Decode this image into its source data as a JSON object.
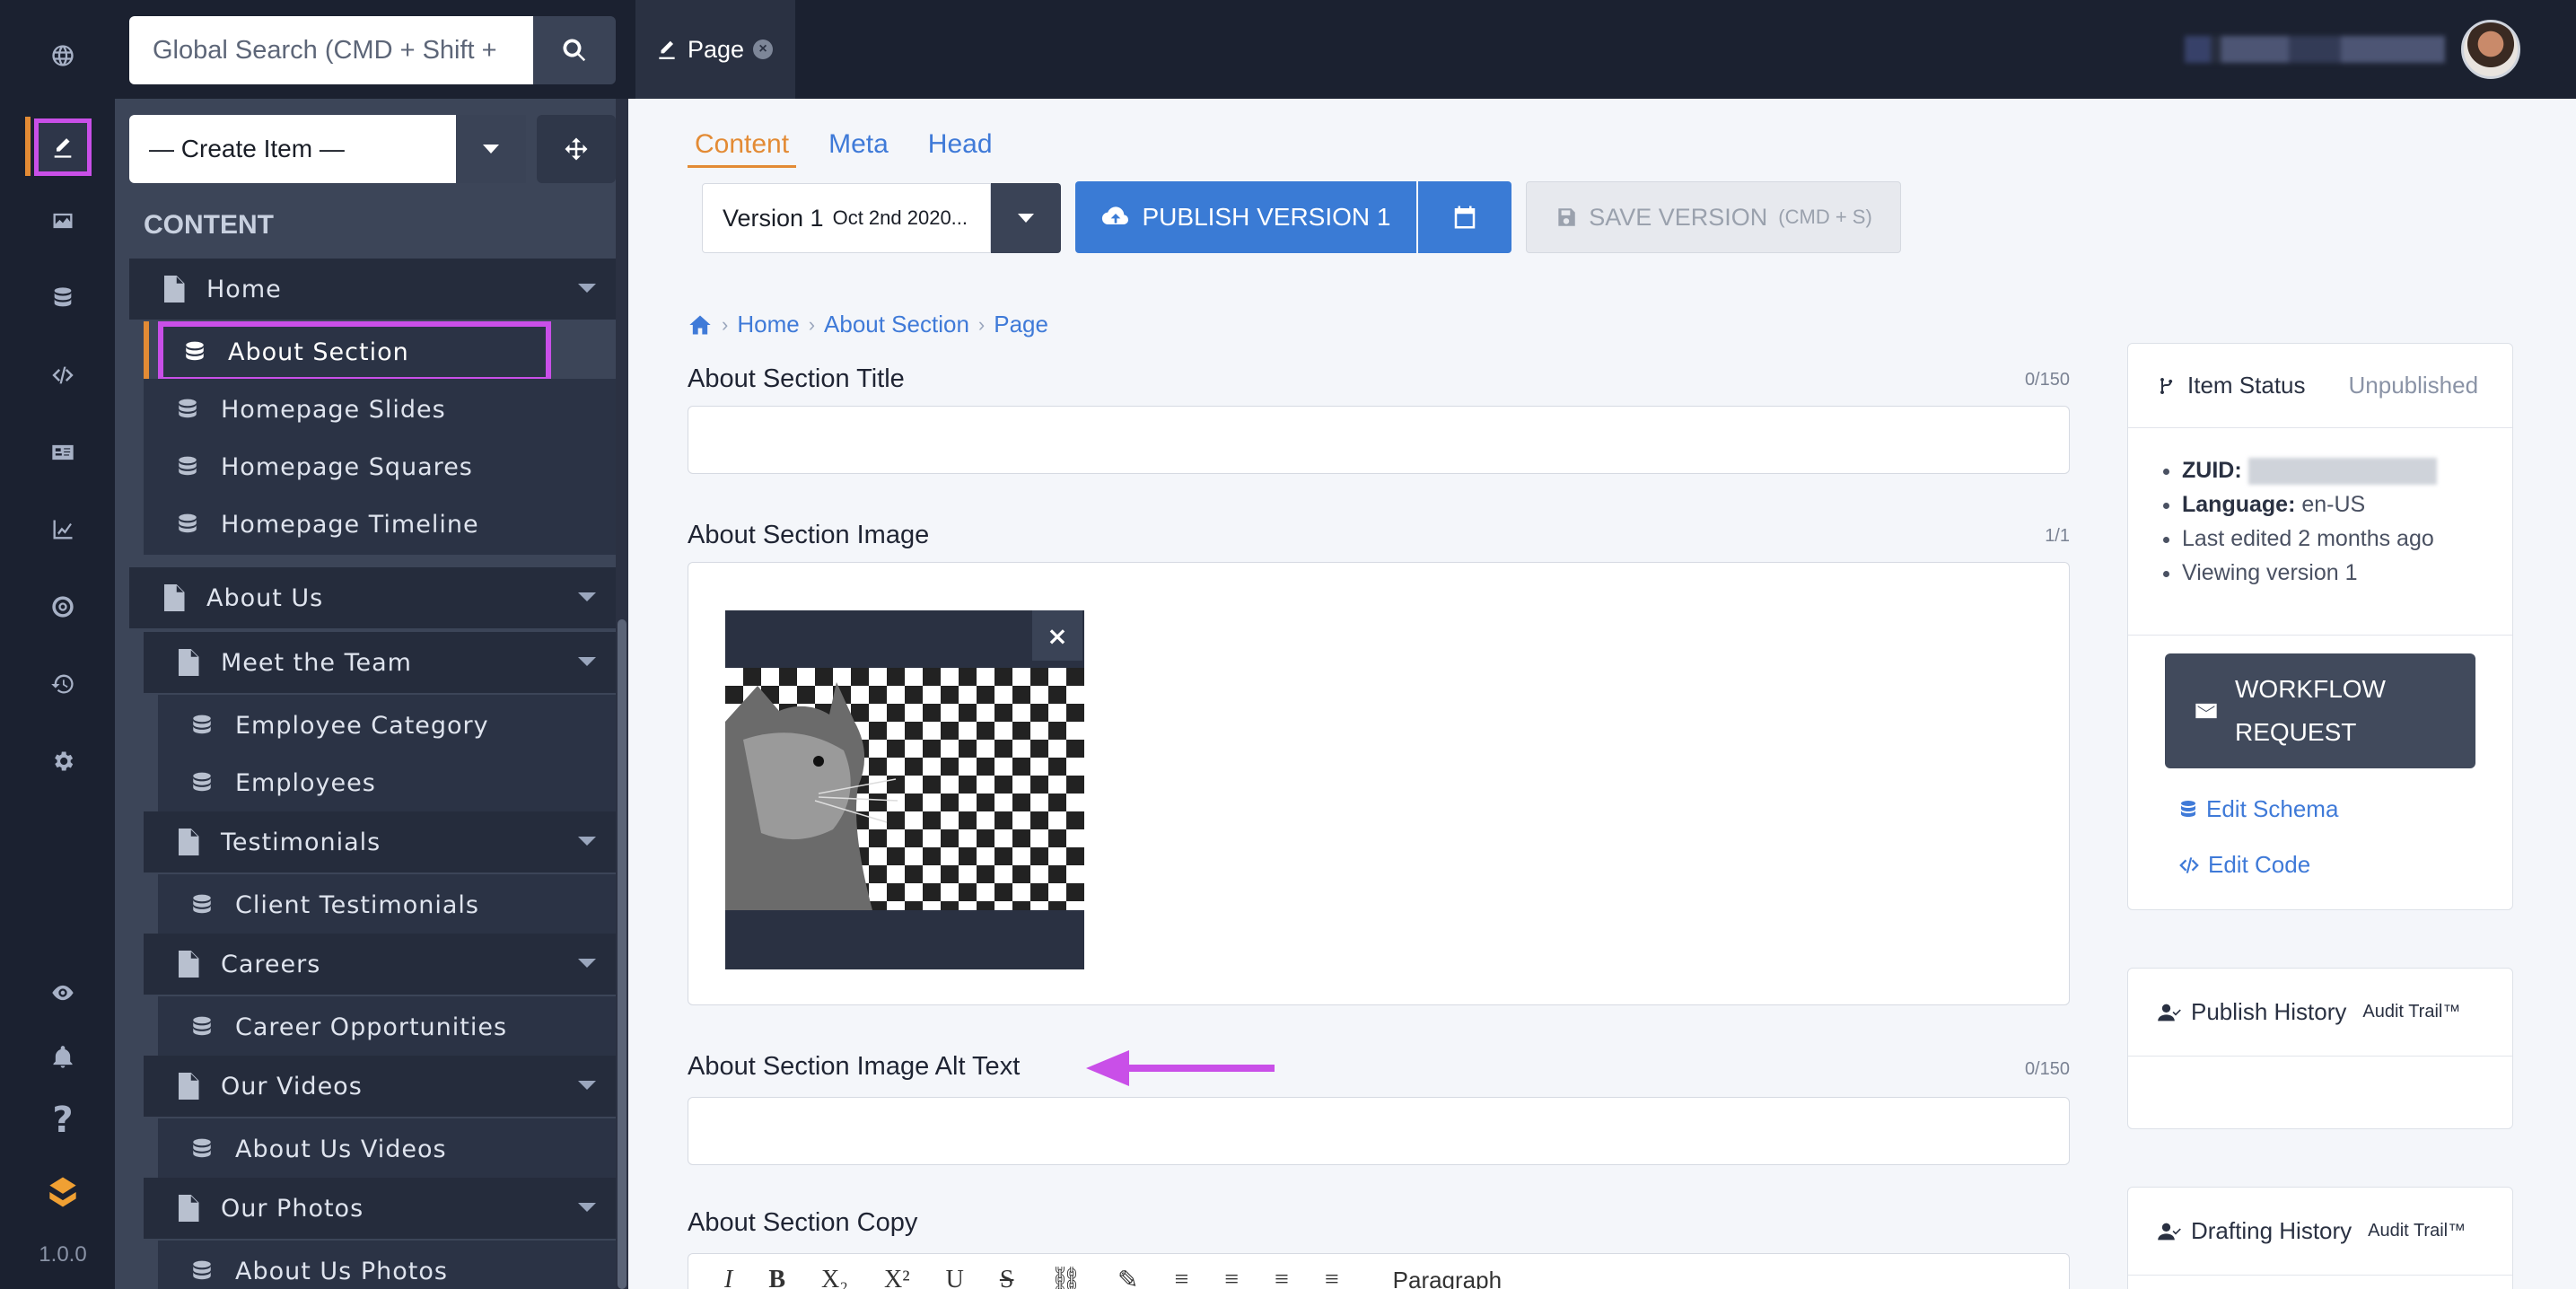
{
  "app": {
    "version": "1.0.0"
  },
  "search": {
    "placeholder": "Global Search (CMD + Shift +"
  },
  "tab": {
    "label": "Page"
  },
  "sidebar": {
    "create_label": "— Create Item —",
    "content_header": "CONTENT",
    "items": [
      {
        "label": "Home",
        "type": "folder"
      },
      {
        "label": "About Section",
        "type": "model"
      },
      {
        "label": "Homepage Slides",
        "type": "model"
      },
      {
        "label": "Homepage Squares",
        "type": "model"
      },
      {
        "label": "Homepage Timeline",
        "type": "model"
      },
      {
        "label": "About Us",
        "type": "folder"
      },
      {
        "label": "Meet the Team",
        "type": "folder"
      },
      {
        "label": "Employee Category",
        "type": "model"
      },
      {
        "label": "Employees",
        "type": "model"
      },
      {
        "label": "Testimonials",
        "type": "folder"
      },
      {
        "label": "Client Testimonials",
        "type": "model"
      },
      {
        "label": "Careers",
        "type": "folder"
      },
      {
        "label": "Career Opportunities",
        "type": "model"
      },
      {
        "label": "Our Videos",
        "type": "folder"
      },
      {
        "label": "About Us Videos",
        "type": "model"
      },
      {
        "label": "Our Photos",
        "type": "folder"
      },
      {
        "label": "About Us Photos",
        "type": "model"
      }
    ]
  },
  "main": {
    "tabs": [
      "Content",
      "Meta",
      "Head"
    ],
    "version_label": "Version 1",
    "version_date": "Oct 2nd 2020...",
    "publish_label": "PUBLISH VERSION 1",
    "save_label": "SAVE VERSION",
    "save_shortcut": "(CMD + S)",
    "breadcrumb": [
      "Home",
      "About Section",
      "Page"
    ],
    "fields": [
      {
        "label": "About Section Title",
        "count": "0/150"
      },
      {
        "label": "About Section Image",
        "count": "1/1"
      },
      {
        "label": "About Section Image Alt Text",
        "count": "0/150"
      },
      {
        "label": "About Section Copy"
      }
    ],
    "editor_style": "Paragraph"
  },
  "status": {
    "title": "Item Status",
    "state": "Unpublished",
    "zuid_label": "ZUID:",
    "language_label": "Language:",
    "language": "en-US",
    "last_edited": "Last edited 2 months ago",
    "viewing": "Viewing version 1",
    "workflow_line1": "WORKFLOW",
    "workflow_line2": "REQUEST",
    "edit_schema": "Edit Schema",
    "edit_code": "Edit Code"
  },
  "publish_history": {
    "title": "Publish History",
    "sub": "Audit Trail™"
  },
  "drafting_history": {
    "title": "Drafting History",
    "sub": "Audit Trail™"
  },
  "colors": {
    "accent": "#3a7bd5",
    "highlight": "#c94fe8",
    "tab_active": "#e38b35"
  }
}
